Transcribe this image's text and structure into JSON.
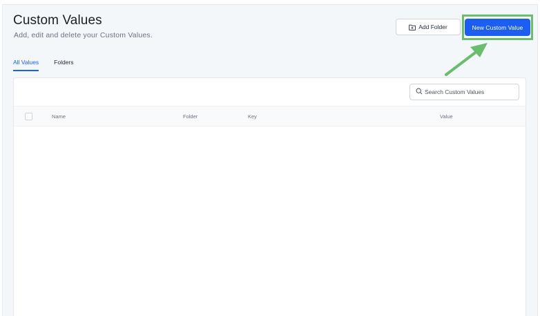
{
  "header": {
    "title": "Custom Values",
    "subtitle": "Add, edit and delete your Custom Values."
  },
  "actions": {
    "add_folder_label": "Add Folder",
    "new_custom_value_label": "New Custom Value"
  },
  "tabs": [
    {
      "label": "All Values",
      "active": true
    },
    {
      "label": "Folders",
      "active": false
    }
  ],
  "search": {
    "placeholder": "Search Custom Values",
    "value": ""
  },
  "table": {
    "columns": [
      "Name",
      "Folder",
      "Key",
      "Value"
    ],
    "rows": []
  },
  "colors": {
    "accent": "#1c5ff0",
    "highlight": "#69bd6c",
    "background": "#f3f7fa"
  }
}
